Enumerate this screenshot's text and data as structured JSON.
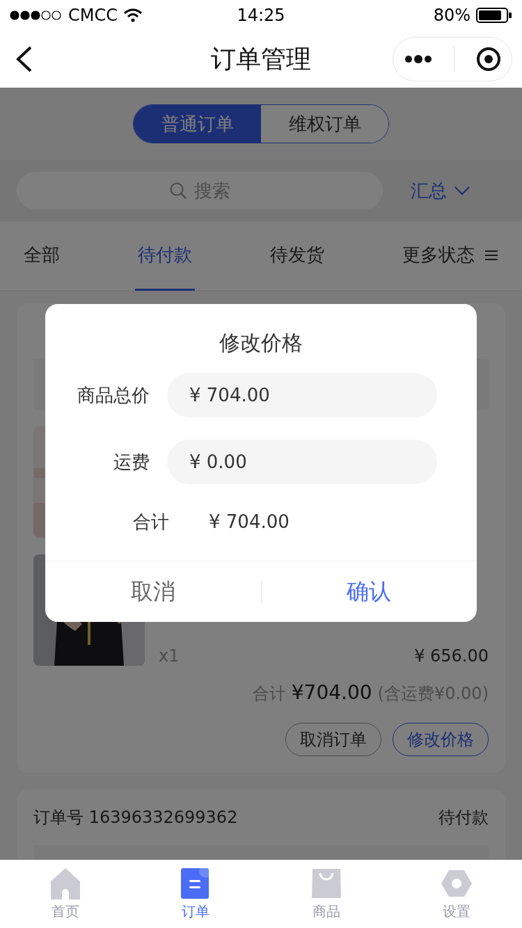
{
  "status_bar": {
    "carrier": "CMCC",
    "time": "14:25",
    "battery": "80%"
  },
  "nav": {
    "title": "订单管理"
  },
  "segments": [
    {
      "label": "普通订单",
      "selected": true
    },
    {
      "label": "维权订单",
      "selected": false
    }
  ],
  "search": {
    "placeholder": "搜索"
  },
  "summary": "汇总",
  "status_tabs": [
    {
      "label": "全部",
      "selected": false
    },
    {
      "label": "待付款",
      "selected": true
    },
    {
      "label": "待发货",
      "selected": false
    },
    {
      "label": "更多状态",
      "selected": false
    }
  ],
  "orders": [
    {
      "items": [
        {
          "kind": "picture"
        },
        {
          "kind": "picture",
          "qty": "x1",
          "price": "¥ 656.00"
        }
      ],
      "total_label": "合计",
      "total": "¥704.00",
      "shipping_note": "(含运费¥0.00)",
      "actions": [
        {
          "label": "取消订单",
          "kind": "secondary"
        },
        {
          "label": "修改价格",
          "kind": "primary"
        }
      ]
    },
    {
      "header_left": "订单号 16396332699362",
      "header_right": "待付款"
    }
  ],
  "modal": {
    "title": "修改价格",
    "fields": [
      {
        "label": "商品总价",
        "value": "¥ 704.00",
        "kind": "input"
      },
      {
        "label": "运费",
        "value": "¥ 0.00",
        "kind": "input"
      },
      {
        "label": "合计",
        "value": "¥ 704.00",
        "kind": "text"
      }
    ],
    "buttons": [
      {
        "label": "取消",
        "kind": "cancel"
      },
      {
        "label": "确认",
        "kind": "confirm"
      }
    ]
  },
  "tabbar": [
    {
      "label": "首页",
      "kind": "home",
      "selected": false
    },
    {
      "label": "订单",
      "kind": "orders",
      "selected": true
    },
    {
      "label": "商品",
      "kind": "goods",
      "selected": false
    },
    {
      "label": "设置",
      "kind": "settings",
      "selected": false
    }
  ]
}
